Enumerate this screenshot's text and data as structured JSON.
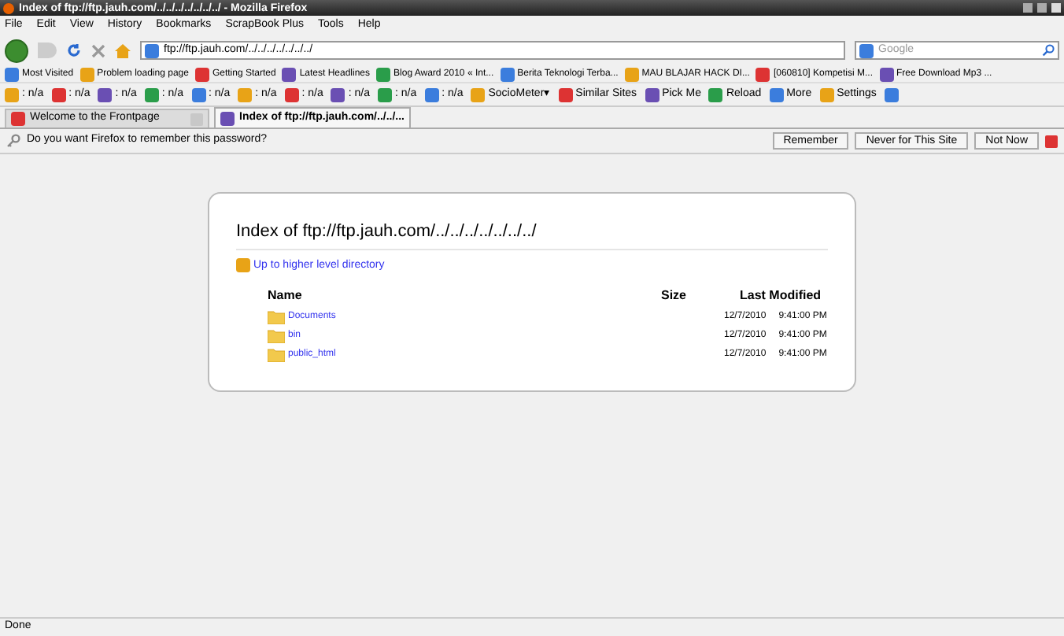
{
  "window": {
    "title": "Index of ftp://ftp.jauh.com/../../../../../../../ - Mozilla Firefox"
  },
  "menu": [
    "File",
    "Edit",
    "View",
    "History",
    "Bookmarks",
    "ScrapBook Plus",
    "Tools",
    "Help"
  ],
  "nav": {
    "url": "ftp://ftp.jauh.com/../../../../../../../",
    "search_placeholder": "Google"
  },
  "bookmarks": [
    "Most Visited",
    "Problem loading page",
    "Getting Started",
    "Latest Headlines",
    "Blog Award 2010 « Int...",
    "Berita Teknologi Terba...",
    "MAU BLAJAR HACK DI...",
    "[060810] Kompetisi M...",
    "Free Download Mp3 ..."
  ],
  "addon_toolbar": [
    {
      "label": ": n/a"
    },
    {
      "label": ": n/a"
    },
    {
      "label": ": n/a"
    },
    {
      "label": ": n/a"
    },
    {
      "label": ": n/a"
    },
    {
      "label": ": n/a"
    },
    {
      "label": ": n/a"
    },
    {
      "label": ": n/a"
    },
    {
      "label": ": n/a"
    },
    {
      "label": ": n/a"
    },
    {
      "label": "SocioMeter▾"
    },
    {
      "label": "Similar Sites"
    },
    {
      "label": "Pick Me"
    },
    {
      "label": "Reload"
    },
    {
      "label": "More"
    },
    {
      "label": "Settings"
    }
  ],
  "tabs": [
    {
      "label": "Welcome to the Frontpage",
      "selected": false
    },
    {
      "label": "Index of ftp://ftp.jauh.com/../../...",
      "selected": true
    }
  ],
  "notification": {
    "text": "Do you want Firefox to remember this password?",
    "buttons": [
      "Remember",
      "Never for This Site",
      "Not Now"
    ]
  },
  "page": {
    "heading": "Index of ftp://ftp.jauh.com/../../../../../../../",
    "up_link": "Up to higher level directory",
    "columns": [
      "Name",
      "Size",
      "Last Modified"
    ],
    "rows": [
      {
        "name": "Documents",
        "date": "12/7/2010",
        "time": "9:41:00 PM"
      },
      {
        "name": "bin",
        "date": "12/7/2010",
        "time": "9:41:00 PM"
      },
      {
        "name": "public_html",
        "date": "12/7/2010",
        "time": "9:41:00 PM"
      }
    ]
  },
  "status_bar": "Done"
}
